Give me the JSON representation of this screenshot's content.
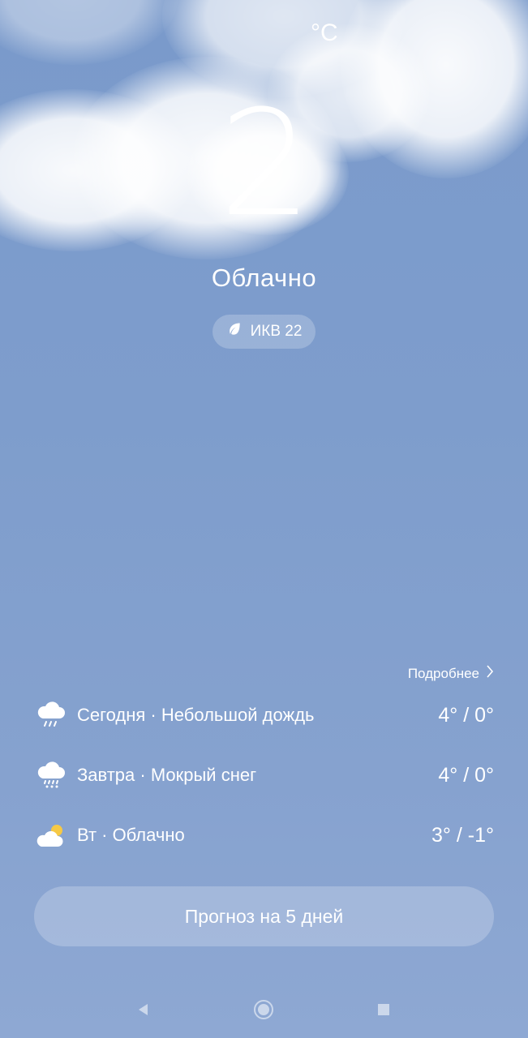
{
  "current": {
    "temperature": "2",
    "unit": "°C",
    "condition": "Облачно",
    "aqi_label": "ИКВ 22"
  },
  "forecast": {
    "more_label": "Подробнее",
    "days": [
      {
        "label": "Сегодня · Небольшой дождь",
        "temps": "4° / 0°",
        "icon": "cloud-rain-icon"
      },
      {
        "label": "Завтра · Мокрый снег",
        "temps": "4° / 0°",
        "icon": "cloud-sleet-icon"
      },
      {
        "label": "Вт · Облачно",
        "temps": "3° / -1°",
        "icon": "partly-cloudy-icon"
      }
    ],
    "five_day_button": "Прогноз на 5 дней"
  },
  "nav": {
    "icons": [
      "back-icon",
      "home-icon",
      "recents-icon"
    ]
  },
  "colors": {
    "sky": "#7e9dcc",
    "sun": "#f6c945",
    "text": "#ffffff"
  }
}
